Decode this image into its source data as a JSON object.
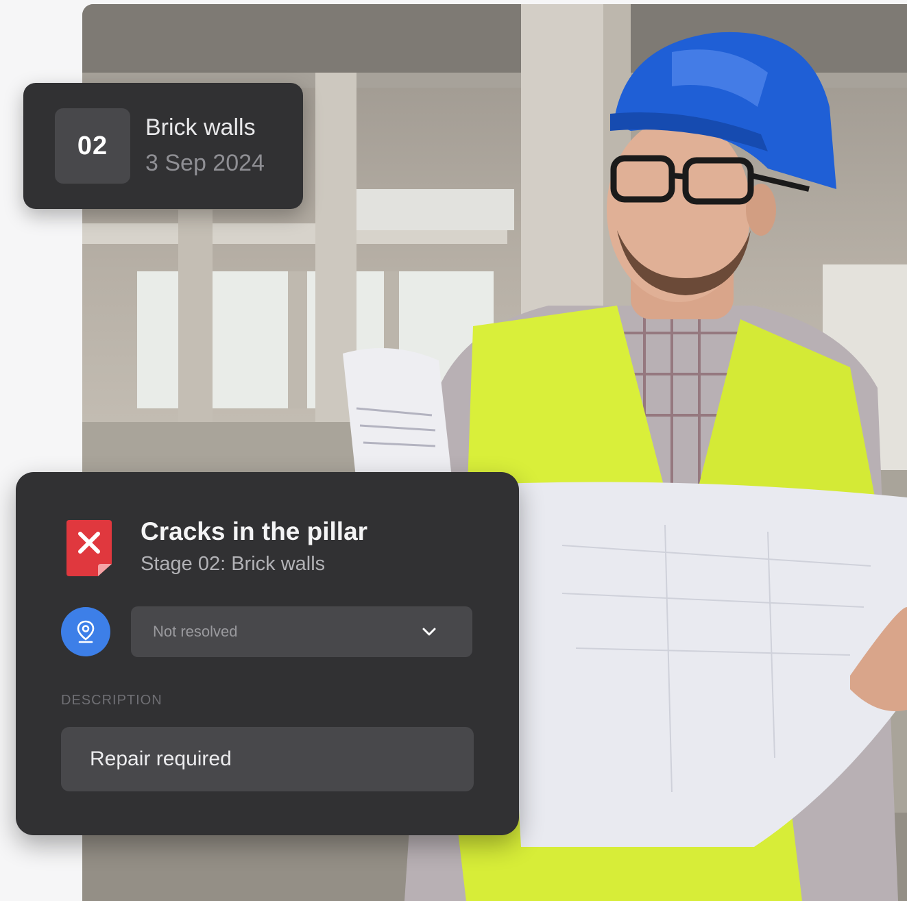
{
  "stage_card": {
    "number": "02",
    "title": "Brick walls",
    "date": "3 Sep 2024"
  },
  "issue_card": {
    "title": "Cracks in the pillar",
    "subtitle": "Stage 02: Brick walls",
    "status": "Not resolved",
    "description_label": "DESCRIPTION",
    "description": "Repair required"
  },
  "icons": {
    "issue": "document-error-icon",
    "location": "location-pin-icon",
    "dropdown": "chevron-down-icon"
  },
  "colors": {
    "card_bg": "#313133",
    "field_bg": "#48484b",
    "accent_blue": "#3d7fe8",
    "error_red": "#e0383e",
    "vest_yellow": "#d9ef3a",
    "helmet_blue": "#1f5fd6"
  }
}
